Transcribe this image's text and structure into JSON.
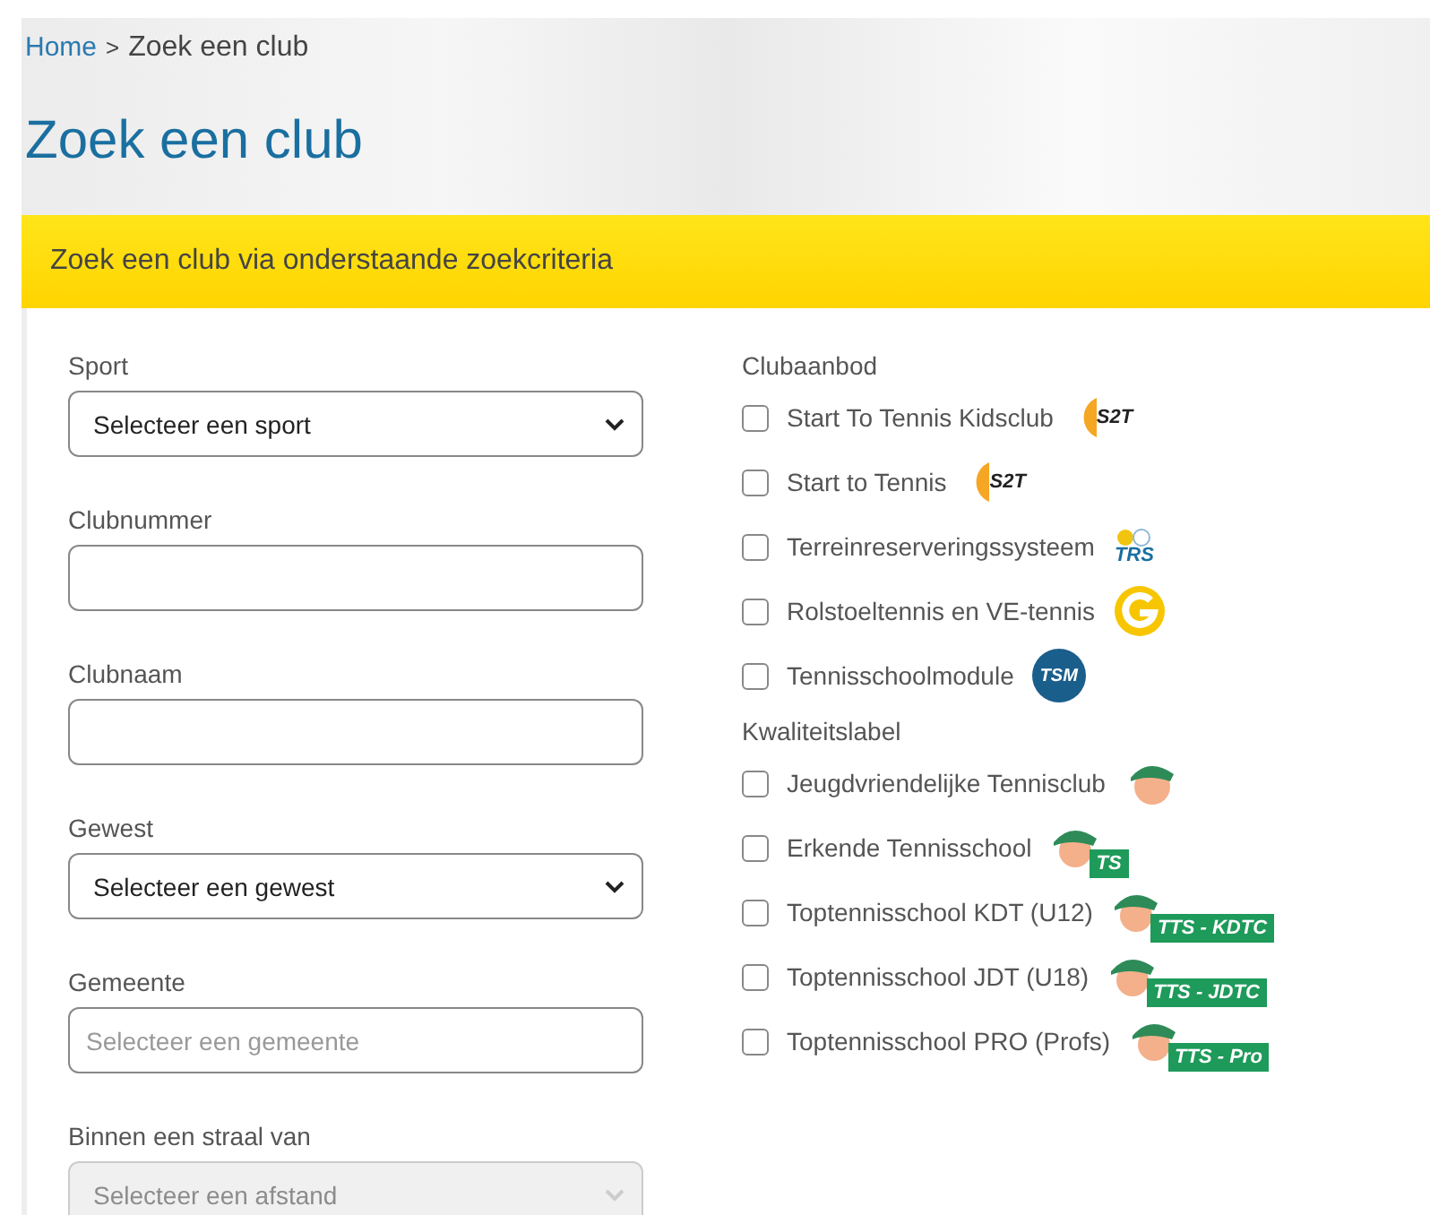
{
  "breadcrumb": {
    "home": "Home",
    "separator": ">",
    "current": "Zoek een club"
  },
  "title": "Zoek een club",
  "banner": "Zoek een club via onderstaande zoekcriteria",
  "fields": [
    {
      "label": "Sport",
      "kind": "select",
      "value": "Selecteer een sport",
      "disabled": false
    },
    {
      "label": "Clubnummer",
      "kind": "input",
      "disabled": false
    },
    {
      "label": "Clubnaam",
      "kind": "input",
      "disabled": false
    },
    {
      "label": "Gewest",
      "kind": "select",
      "value": "Selecteer een gewest",
      "disabled": false
    },
    {
      "label": "Gemeente",
      "kind": "input",
      "placeholder": "Selecteer een gemeente",
      "disabled": false
    },
    {
      "label": "Binnen een straal van",
      "kind": "select",
      "value": "Selecteer een afstand",
      "disabled": true
    }
  ],
  "groups": [
    {
      "title": "Clubaanbod",
      "options": [
        {
          "label": "Start To Tennis Kidsclub",
          "checked": false,
          "logo": {
            "kind": "s2t",
            "text": "S2T"
          }
        },
        {
          "label": "Start to Tennis",
          "checked": false,
          "logo": {
            "kind": "s2t",
            "text": "S2T"
          }
        },
        {
          "label": "Terreinreserveringssysteem",
          "checked": false,
          "logo": {
            "kind": "trs",
            "text": "TRS"
          }
        },
        {
          "label": "Rolstoeltennis en VE-tennis",
          "checked": false,
          "logo": {
            "kind": "g"
          }
        },
        {
          "label": "Tennisschoolmodule",
          "checked": false,
          "logo": {
            "kind": "tsm",
            "text": "TSM"
          }
        }
      ]
    },
    {
      "title": "Kwaliteitslabel",
      "options": [
        {
          "label": "Jeugdvriendelijke Tennisclub",
          "checked": false,
          "logo": {
            "kind": "cap"
          }
        },
        {
          "label": "Erkende Tennisschool",
          "checked": false,
          "logo": {
            "kind": "cap-badge",
            "text": "TS"
          }
        },
        {
          "label": "Toptennisschool KDT (U12)",
          "checked": false,
          "logo": {
            "kind": "cap-badge",
            "text": "TTS - KDTC"
          }
        },
        {
          "label": "Toptennisschool JDT (U18)",
          "checked": false,
          "logo": {
            "kind": "cap-badge",
            "text": "TTS - JDTC"
          }
        },
        {
          "label": "Toptennisschool PRO (Profs)",
          "checked": false,
          "logo": {
            "kind": "cap-badge",
            "text": "TTS - Pro"
          }
        }
      ]
    }
  ]
}
